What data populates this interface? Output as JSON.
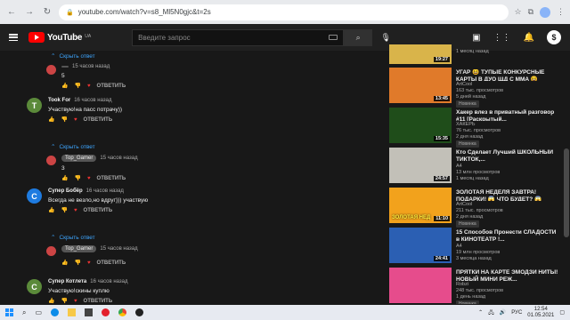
{
  "browser": {
    "url": "youtube.com/watch?v=s8_Ml5N0gjc&t=2s"
  },
  "header": {
    "logo_text": "YouTube",
    "logo_region": "UA",
    "search_placeholder": "Введите запрос"
  },
  "comments": {
    "hide_replies_label": "Скрыть ответ",
    "reply_label": "ОТВЕТИТЬ",
    "blocks": [
      {
        "type": "reply",
        "author": "",
        "time": "15 часов назад",
        "text": "5",
        "show_toggle": true
      },
      {
        "type": "comment",
        "author": "Took For",
        "time": "16 часов назад",
        "text": "Участвую!на пасс потрачу))",
        "avatar_letter": "T",
        "avatar_color": "#5b8a3a"
      },
      {
        "type": "reply",
        "author": "Top_Gamer",
        "time": "15 часов назад",
        "text": "3",
        "show_toggle": true
      },
      {
        "type": "comment",
        "author": "Супер Бобёр",
        "time": "16 часов назад",
        "text": "Всегда не везло,но вдруг))) участвую",
        "avatar_letter": "С",
        "avatar_color": "#1e7be0"
      },
      {
        "type": "reply",
        "author": "Top_Gamer",
        "time": "15 часов назад",
        "text": "",
        "show_toggle": true
      },
      {
        "type": "comment",
        "author": "Супер Котлета",
        "time": "16 часов назад",
        "text": "Участвую!скины куплю",
        "avatar_letter": "С",
        "avatar_color": "#5b8a3a"
      }
    ],
    "last_toggle": "Скрыть ответ"
  },
  "sidebar": {
    "videos": [
      {
        "title": "",
        "channel": "",
        "views": "",
        "age": "1 месяц назад",
        "duration": "19:27",
        "thumb_color": "#d9b44a",
        "badge": ""
      },
      {
        "title": "УГАР 😆 ТУПЫЕ КОНКУРСНЫЕ КАРТЫ В ДУО ЩД С ММА 😆",
        "channel": "ArtCool",
        "views": "163 тыс. просмотров",
        "age": "5 дней назад",
        "duration": "13:45",
        "thumb_color": "#e07a2a",
        "badge": "Новинка"
      },
      {
        "title": "Хакер влез в приватный разговор #11 [Раскрытый...",
        "channel": "ХАКЕРЬ",
        "views": "76 тыс. просмотров",
        "age": "2 дня назад",
        "duration": "15:35",
        "thumb_color": "#1f4d1a",
        "badge": "Новинка"
      },
      {
        "title": "Кто Сделает Лучший ШКОЛЬНЫЙ ТИКТОК,...",
        "channel": "A4",
        "views": "13 млн просмотров",
        "age": "1 месяц назад",
        "duration": "24:57",
        "thumb_color": "#c2c0b8",
        "badge": ""
      },
      {
        "title": "ЗОЛОТАЯ НЕДЕЛЯ ЗАВТРА! ПОДАРКИ! 😱 ЧТО БУДЕТ? 😱",
        "channel": "ArtCool",
        "views": "211 тыс. просмотров",
        "age": "2 дня назад",
        "duration": "11:10",
        "thumb_color": "#f2a21c",
        "thumb_text": "ЗОЛОТАЯ НЕД",
        "badge": "Новинка"
      },
      {
        "title": "15 Способов Пронести СЛАДОСТИ в КИНОТЕАТР !...",
        "channel": "A4",
        "views": "19 млн просмотров",
        "age": "3 месяца назад",
        "duration": "24:41",
        "thumb_color": "#2b5fb3",
        "badge": ""
      },
      {
        "title": "ПРЯТКИ НА КАРТЕ ЭМОДЗИ НИТЫ! НОВЫЙ МИНИ РЕЖ...",
        "channel": "Robzi",
        "views": "248 тыс. просмотров",
        "age": "1 день назад",
        "duration": "",
        "thumb_color": "#e64c8c",
        "badge": "Новинка"
      }
    ]
  },
  "taskbar": {
    "lang": "РУС",
    "time": "12:54",
    "date": "01.05.2021"
  }
}
